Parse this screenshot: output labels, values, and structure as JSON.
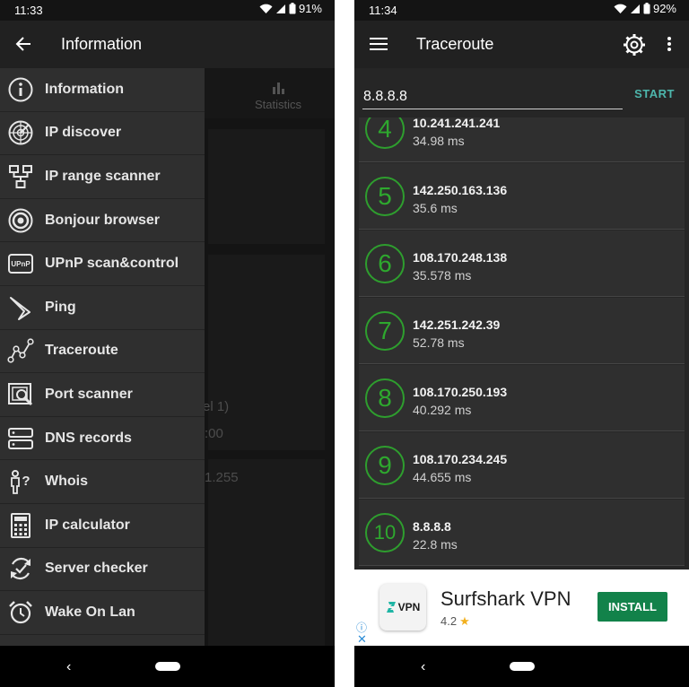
{
  "left": {
    "status": {
      "time": "11:33",
      "battery": "91%"
    },
    "appbar": {
      "title": "Information"
    },
    "background": {
      "tab_statistics": "Statistics",
      "partial_text_1": "el 1)",
      "partial_text_2": ":00",
      "partial_text_3": "1.255"
    },
    "drawer": {
      "items": [
        {
          "label": "Information",
          "icon": "info-icon"
        },
        {
          "label": "IP discover",
          "icon": "radar-icon"
        },
        {
          "label": "IP range scanner",
          "icon": "network-tree-icon"
        },
        {
          "label": "Bonjour browser",
          "icon": "bonjour-icon"
        },
        {
          "label": "UPnP scan&control",
          "icon": "upnp-icon"
        },
        {
          "label": "Ping",
          "icon": "boomerang-icon"
        },
        {
          "label": "Traceroute",
          "icon": "traceroute-icon"
        },
        {
          "label": "Port scanner",
          "icon": "port-scanner-icon"
        },
        {
          "label": "DNS records",
          "icon": "server-icon"
        },
        {
          "label": "Whois",
          "icon": "whois-icon"
        },
        {
          "label": "IP calculator",
          "icon": "calculator-icon"
        },
        {
          "label": "Server checker",
          "icon": "server-checker-icon"
        },
        {
          "label": "Wake On Lan",
          "icon": "alarm-clock-icon"
        }
      ]
    }
  },
  "right": {
    "status": {
      "time": "11:34",
      "battery": "92%"
    },
    "appbar": {
      "title": "Traceroute"
    },
    "host_input": {
      "value": "8.8.8.8"
    },
    "start_label": "START",
    "hops": [
      {
        "num": "4",
        "ip": "10.241.241.241",
        "ms": "34.98 ms"
      },
      {
        "num": "5",
        "ip": "142.250.163.136",
        "ms": "35.6 ms"
      },
      {
        "num": "6",
        "ip": "108.170.248.138",
        "ms": "35.578 ms"
      },
      {
        "num": "7",
        "ip": "142.251.242.39",
        "ms": "52.78 ms"
      },
      {
        "num": "8",
        "ip": "108.170.250.193",
        "ms": "40.292 ms"
      },
      {
        "num": "9",
        "ip": "108.170.234.245",
        "ms": "44.655 ms"
      },
      {
        "num": "10",
        "ip": "8.8.8.8",
        "ms": "22.8 ms"
      }
    ],
    "ad": {
      "title": "Surfshark VPN",
      "rating": "4.2",
      "install_label": "INSTALL",
      "logo_text": "VPN"
    }
  },
  "colors": {
    "accent": "#4db6ac",
    "hop_green": "#2ea82e",
    "install_green": "#12824a"
  }
}
